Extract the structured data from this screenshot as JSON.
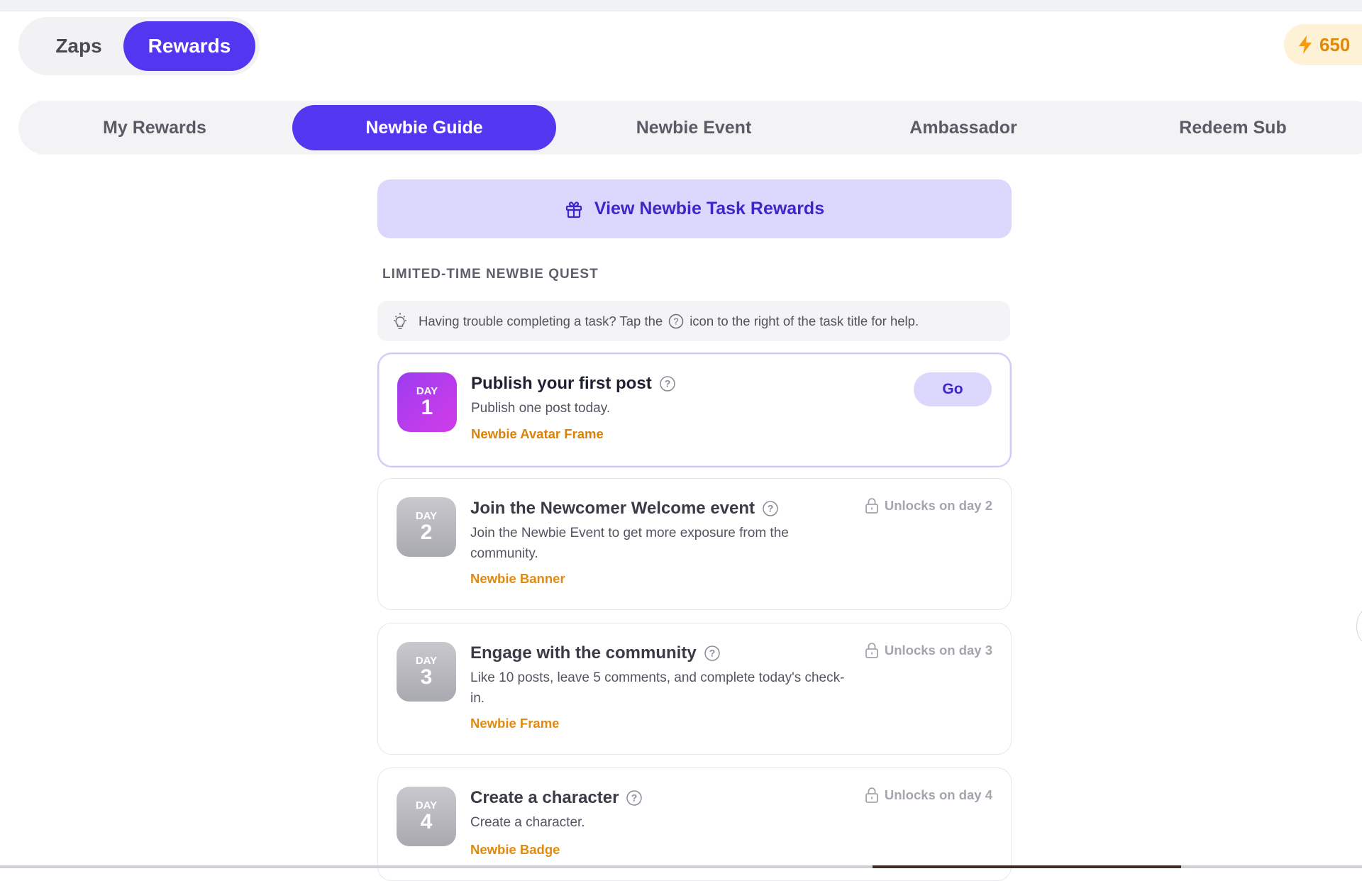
{
  "primary_tabs": {
    "zaps": "Zaps",
    "rewards": "Rewards"
  },
  "balance": {
    "icon": "lightning-icon",
    "value": "650",
    "color": "#e28a06"
  },
  "sub_tabs": [
    "My Rewards",
    "Newbie Guide",
    "Newbie Event",
    "Ambassador",
    "Redeem Sub"
  ],
  "active_sub_tab": "Newbie Guide",
  "view_rewards": {
    "icon": "gift-icon",
    "label": "View Newbie Task Rewards"
  },
  "section_title": "LIMITED-TIME NEWBIE QUEST",
  "tip": {
    "before": "Having trouble completing a task? Tap the",
    "after": "icon to the right of the task title for help."
  },
  "tasks": [
    {
      "day_word": "DAY",
      "day": "1",
      "title": "Publish your first post",
      "description": "Publish one post today.",
      "reward": "Newbie Avatar Frame",
      "action": "Go"
    },
    {
      "day_word": "DAY",
      "day": "2",
      "title": "Join the Newcomer Welcome event",
      "description": "Join the Newbie Event to get more exposure from the community.",
      "reward": "Newbie Banner",
      "status": "Unlocks on day 2"
    },
    {
      "day_word": "DAY",
      "day": "3",
      "title": "Engage with the community",
      "description": "Like 10 posts, leave 5 comments, and complete today's check-in.",
      "reward": "Newbie Frame",
      "status": "Unlocks on day 3"
    },
    {
      "day_word": "DAY",
      "day": "4",
      "title": "Create a character",
      "description": "Create a character.",
      "reward": "Newbie Badge",
      "status": "Unlocks on day 4"
    }
  ],
  "colors": {
    "accent": "#5236f0",
    "accent_soft": "#dcd8fd",
    "reward": "#e08a12"
  }
}
